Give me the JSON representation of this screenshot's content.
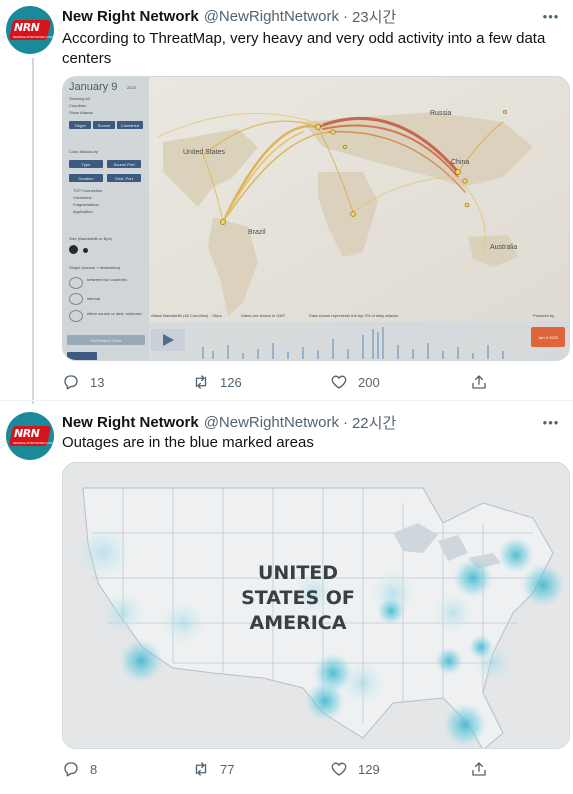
{
  "tweets": [
    {
      "name": "New Right Network",
      "handle": "@NewRightNetwork",
      "time": "23시간",
      "text": "According to ThreatMap, very heavy and very odd activity into a few data centers",
      "replies": "13",
      "retweets": "126",
      "likes": "200",
      "media": {
        "title": "January 9",
        "year": "2023",
        "countries": [
          "United States",
          "Brazil",
          "Russia",
          "China",
          "Australia"
        ],
        "panel": {
          "showing": "Showing All",
          "countries_label": "Countries",
          "show_attacks": "Show Attacks",
          "buttons_top": [
            "Target",
            "Source",
            "Combined"
          ],
          "color_label": "Color Attacks by",
          "buttons_color": [
            "Type",
            "Source Port",
            "Duration",
            "Dest. Port"
          ],
          "legend": [
            "TCP Connection",
            "Volumetric",
            "Fragmentation",
            "Application"
          ],
          "size_label": "Size (Bandwidth or Bps)",
          "shape_label": "Shape (source + destination)",
          "shapes": [
            "between two countries",
            "internal",
            "either source or dest. unknown"
          ],
          "bottom_button": "Get Embed Code"
        },
        "footer": "Attack Bandwidth (All Countries) · Gbps",
        "footer2": "Dates are shown in GMT",
        "footer3": "Data shown represents the top 2% of daily attacks",
        "date_badge": "Jan 9 2023",
        "credit": "Powered by"
      }
    },
    {
      "name": "New Right Network",
      "handle": "@NewRightNetwork",
      "time": "22시간",
      "text": "Outages are in the blue marked areas",
      "replies": "8",
      "retweets": "77",
      "likes": "129",
      "media": {
        "label_line1": "UNITED",
        "label_line2": "STATES OF",
        "label_line3": "AMERICA"
      }
    }
  ],
  "avatar_logo": "NRN",
  "avatar_sub": "NEWRIGHTNETWORK.COM",
  "colors": {
    "text_primary": "#0f1419",
    "text_secondary": "#536471",
    "border": "#cfd9de",
    "thread_line": "#cfd9de",
    "outage_blue": "#4fc1d6"
  }
}
